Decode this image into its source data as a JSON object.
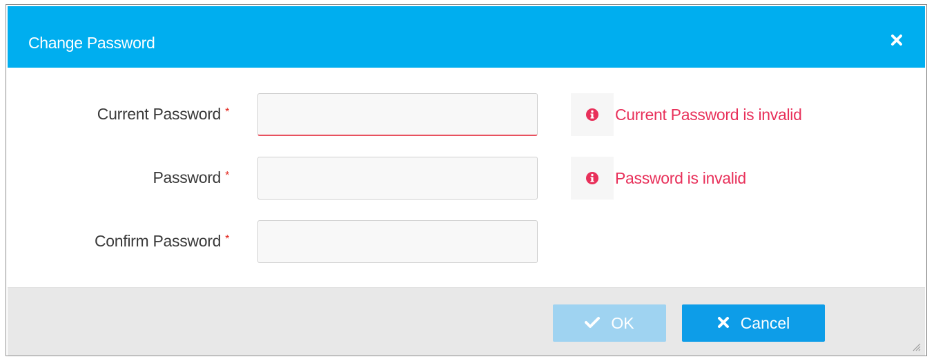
{
  "dialog": {
    "title": "Change Password",
    "close_icon": "close-icon",
    "header_color": "#00aeef"
  },
  "form": {
    "fields": [
      {
        "label": "Current Password",
        "required_marker": "*",
        "value": "",
        "error": "Current Password is invalid",
        "error_icon": "info-circle-icon"
      },
      {
        "label": "Password",
        "required_marker": "*",
        "value": "",
        "error": "Password is invalid",
        "error_icon": "info-circle-icon"
      },
      {
        "label": "Confirm Password",
        "required_marker": "*",
        "value": ""
      }
    ],
    "error_color": "#e8305a"
  },
  "footer": {
    "ok_label": "OK",
    "ok_icon": "check-icon",
    "ok_disabled": true,
    "cancel_label": "Cancel",
    "cancel_icon": "close-icon",
    "button_color": "#0d9de8"
  }
}
